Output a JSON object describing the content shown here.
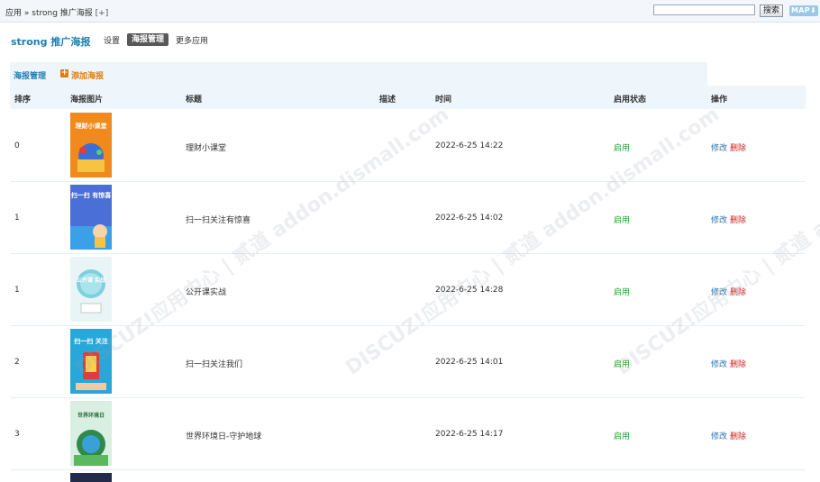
{
  "breadcrumb": {
    "app": "应用",
    "sep": "»",
    "current": "strong 推广海报",
    "add": "[+]"
  },
  "search": {
    "placeholder": "",
    "button": "搜索"
  },
  "map_label": "MAP",
  "plugin_title": "strong 推广海报",
  "nav": {
    "settings": "设置",
    "manage": "海报管理",
    "more": "更多应用"
  },
  "sub": {
    "manage": "海报管理",
    "add": "添加海报"
  },
  "columns": [
    "排序",
    "海报图片",
    "标题",
    "描述",
    "时间",
    "启用状态",
    "操作"
  ],
  "rows": [
    {
      "order": "0",
      "title": "理财小课堂",
      "desc": "",
      "time": "2022-6-25 14:22",
      "status": "启用",
      "edit": "修改",
      "del": "删除",
      "poster_text": "理财小课堂"
    },
    {
      "order": "1",
      "title": "扫一扫关注有惊喜",
      "desc": "",
      "time": "2022-6-25 14:02",
      "status": "启用",
      "edit": "修改",
      "del": "删除",
      "poster_text": "扫一扫 有惊喜"
    },
    {
      "order": "1",
      "title": "公开课实战",
      "desc": "",
      "time": "2022-6-25 14:28",
      "status": "启用",
      "edit": "修改",
      "del": "删除",
      "poster_text": "公开课 实战"
    },
    {
      "order": "2",
      "title": "扫一扫关注我们",
      "desc": "",
      "time": "2022-6-25 14:01",
      "status": "启用",
      "edit": "修改",
      "del": "删除",
      "poster_text": "扫一扫 关注"
    },
    {
      "order": "3",
      "title": "世界环境日-守护地球",
      "desc": "",
      "time": "2022-6-25 14:17",
      "status": "启用",
      "edit": "修改",
      "del": "删除",
      "poster_text": "世界环境日"
    }
  ],
  "watermark": "DISCUZ!应用中心 | 贰道 addon.dismall.com",
  "colors": {
    "accent": "#1d7fb0",
    "status": "#2a9a2a",
    "delete": "#d02020",
    "add": "#e07d10"
  }
}
